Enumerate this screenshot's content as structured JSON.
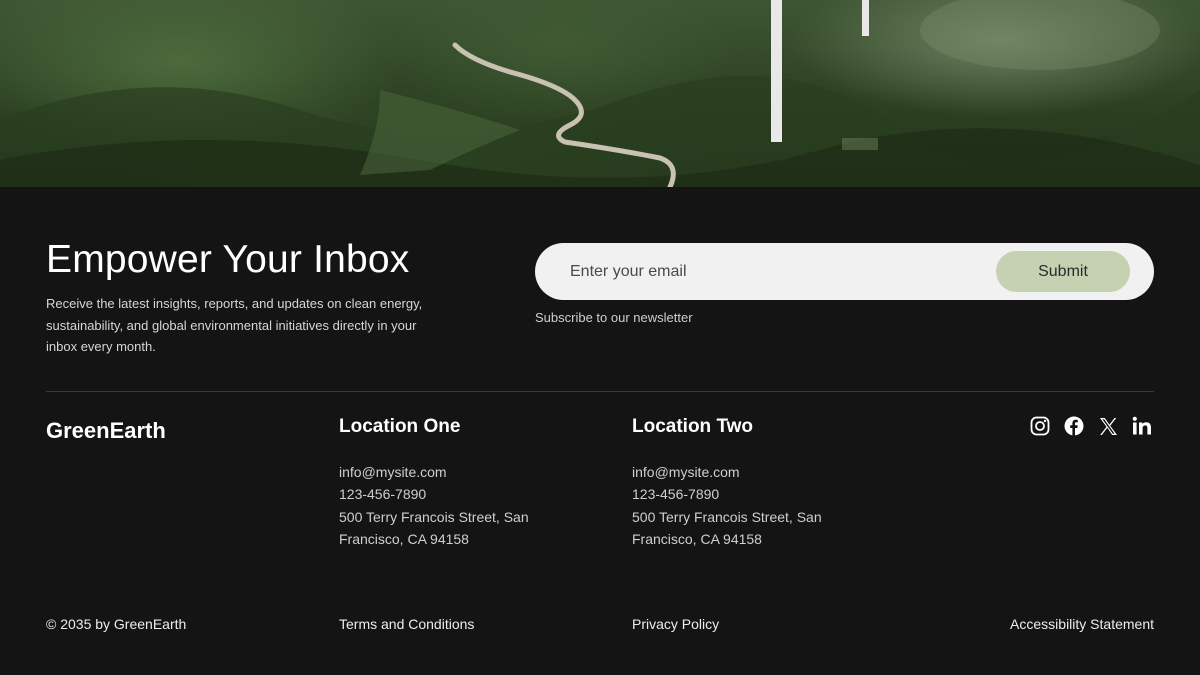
{
  "newsletter": {
    "title": "Empower Your Inbox",
    "description": "Receive the latest insights, reports, and updates on clean energy, sustainability, and global environmental initiatives directly in your inbox every month.",
    "email_placeholder": "Enter your email",
    "submit_label": "Submit",
    "subscribe_caption": "Subscribe to our newsletter"
  },
  "brand": {
    "name": "GreenEarth"
  },
  "locations": [
    {
      "title": "Location One",
      "email": "info@mysite.com",
      "phone": "123-456-7890",
      "address_line1": "500 Terry Francois Street, San",
      "address_line2": "Francisco, CA 94158"
    },
    {
      "title": "Location Two",
      "email": "info@mysite.com",
      "phone": "123-456-7890",
      "address_line1": "500 Terry Francois Street, San",
      "address_line2": "Francisco, CA 94158"
    }
  ],
  "socials": [
    {
      "icon": "instagram-icon"
    },
    {
      "icon": "facebook-icon"
    },
    {
      "icon": "x-icon"
    },
    {
      "icon": "linkedin-icon"
    }
  ],
  "footer": {
    "copyright": "© 2035 by GreenEarth",
    "terms": "Terms and Conditions",
    "privacy": "Privacy Policy",
    "accessibility": "Accessibility Statement"
  },
  "colors": {
    "background": "#141414",
    "input_bg": "#f1f1f1",
    "button_bg": "#c5d1b1",
    "text": "#ffffff"
  }
}
